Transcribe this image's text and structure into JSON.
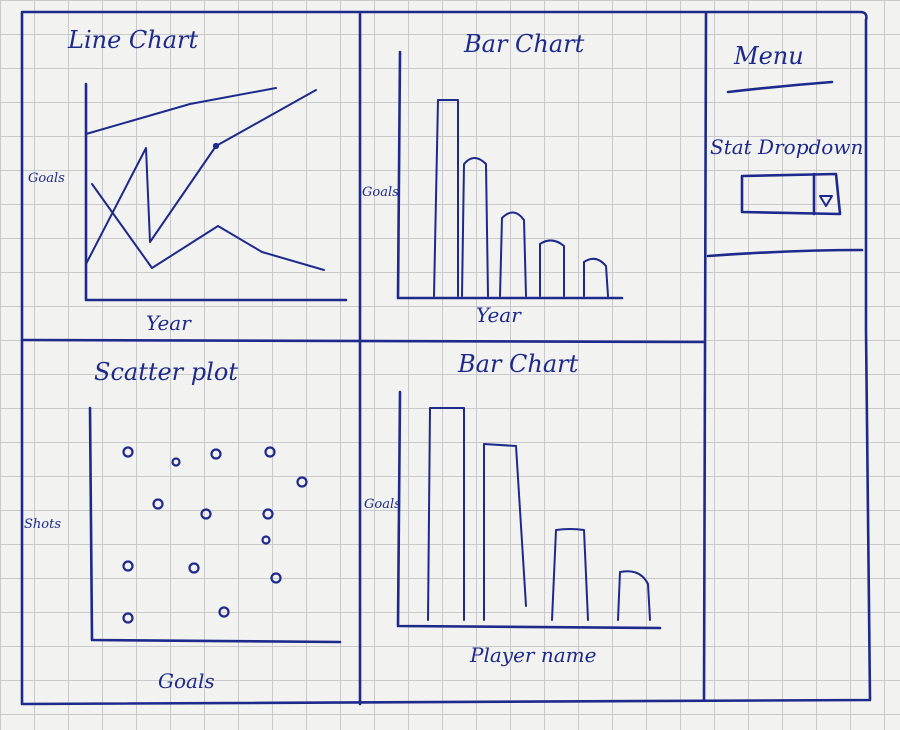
{
  "panels": {
    "line_chart": {
      "title": "Line Chart",
      "ylabel": "Goals",
      "xlabel": "Year"
    },
    "bar_chart_top": {
      "title": "Bar Chart",
      "ylabel": "Goals",
      "xlabel": "Year"
    },
    "scatter_plot": {
      "title": "Scatter plot",
      "ylabel": "Shots",
      "xlabel": "Goals"
    },
    "bar_chart_bottom": {
      "title": "Bar Chart",
      "ylabel": "Goals",
      "xlabel": "Player name"
    }
  },
  "menu": {
    "title": "Menu",
    "dropdown_label": "Stat Dropdown",
    "dropdown_value": "",
    "dropdown_icon": "chevron-down-icon"
  },
  "colors": {
    "ink": "#1d2a8c",
    "paper": "#f2f2f0",
    "grid": "#c9c9cc"
  }
}
